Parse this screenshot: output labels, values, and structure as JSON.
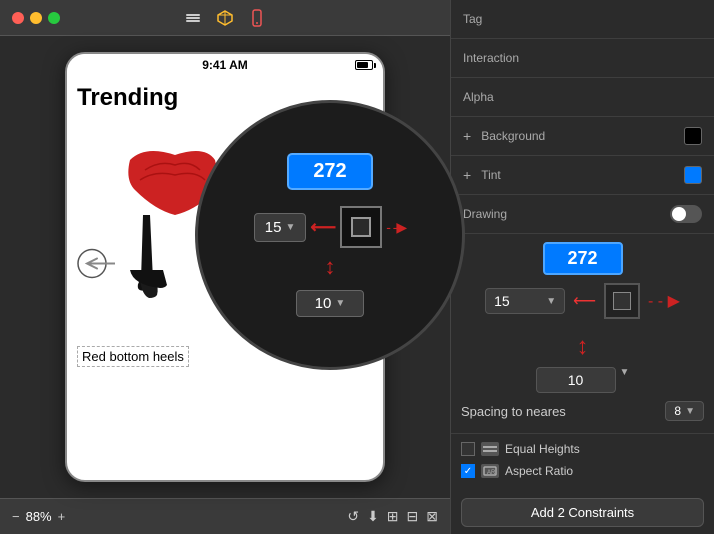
{
  "toolbar": {
    "dots": [
      "red",
      "yellow",
      "green"
    ],
    "icons": [
      "square-stack-icon",
      "cube-icon",
      "phone-icon"
    ]
  },
  "phone": {
    "status_time": "9:41 AM",
    "title": "Trending",
    "caption": "Red bottom heels"
  },
  "bottom_toolbar": {
    "minus_label": "−",
    "zoom_value": "88%",
    "plus_label": "+"
  },
  "right_panel": {
    "tag_label": "Tag",
    "interaction_label": "Interaction",
    "alpha_label": "Alpha",
    "background_label": "Background",
    "tint_label": "Tint",
    "drawing_label": "Drawing"
  },
  "constraints": {
    "value_272": "272",
    "select_15": "15",
    "select_10": "10",
    "spacing_label": "Spacing to neares",
    "spacing_value": "8",
    "equal_heights_label": "Equal Heights",
    "aspect_ratio_label": "Aspect Ratio",
    "add_button_label": "Add 2 Constraints"
  }
}
